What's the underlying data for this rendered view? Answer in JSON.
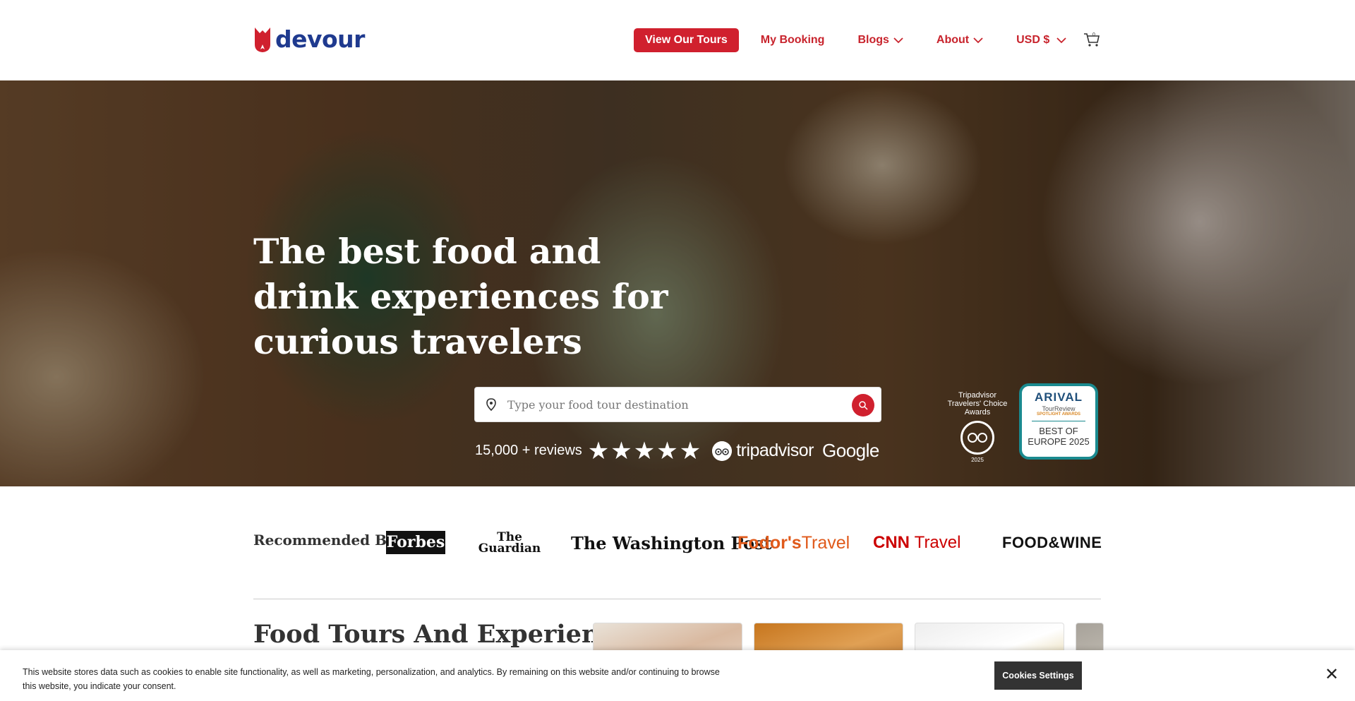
{
  "header": {
    "logo_text": "devour",
    "brand_color": "#d0202e",
    "logo_color": "#1f3a8f",
    "nav": {
      "view_tours": "View Our Tours",
      "my_booking": "My Booking",
      "blogs": "Blogs",
      "about": "About",
      "currency": "USD $"
    },
    "cart_icon": "cart-icon"
  },
  "hero": {
    "title": "The best food and drink experiences for curious travelers",
    "search_placeholder": "Type your food tour destination",
    "reviews_count": "15,000 + reviews",
    "stars": "★★★★★",
    "tripadvisor": "tripadvisor",
    "google": "Google",
    "award_tripadvisor": "Tripadvisor Travelers' Choice Awards",
    "award_tripadvisor_year": "2025",
    "award_arival_brand": "ARIVAL",
    "award_arival_sub": "TourReview",
    "award_arival_tag": "SPOTLIGHT AWARDS",
    "award_arival_title": "BEST OF EUROPE 2025"
  },
  "recommended": {
    "label": "Recommended By",
    "publications": {
      "forbes": "Forbes",
      "guardian": "The Guardian",
      "wapo": "The Washington Post",
      "fodors_a": "Fodor's",
      "fodors_b": "Travel",
      "cnn_a": "CNN",
      "cnn_b": "Travel",
      "foodwine": "FOOD&WINE"
    }
  },
  "tours": {
    "title": "Food Tours And Experiences"
  },
  "cookie": {
    "text": "This website stores data such as cookies to enable site functionality, as well as marketing, personalization, and analytics. By remaining on this website and/or continuing to browse this website, you indicate your consent.",
    "settings_button": "Cookies Settings",
    "close": "✕"
  }
}
